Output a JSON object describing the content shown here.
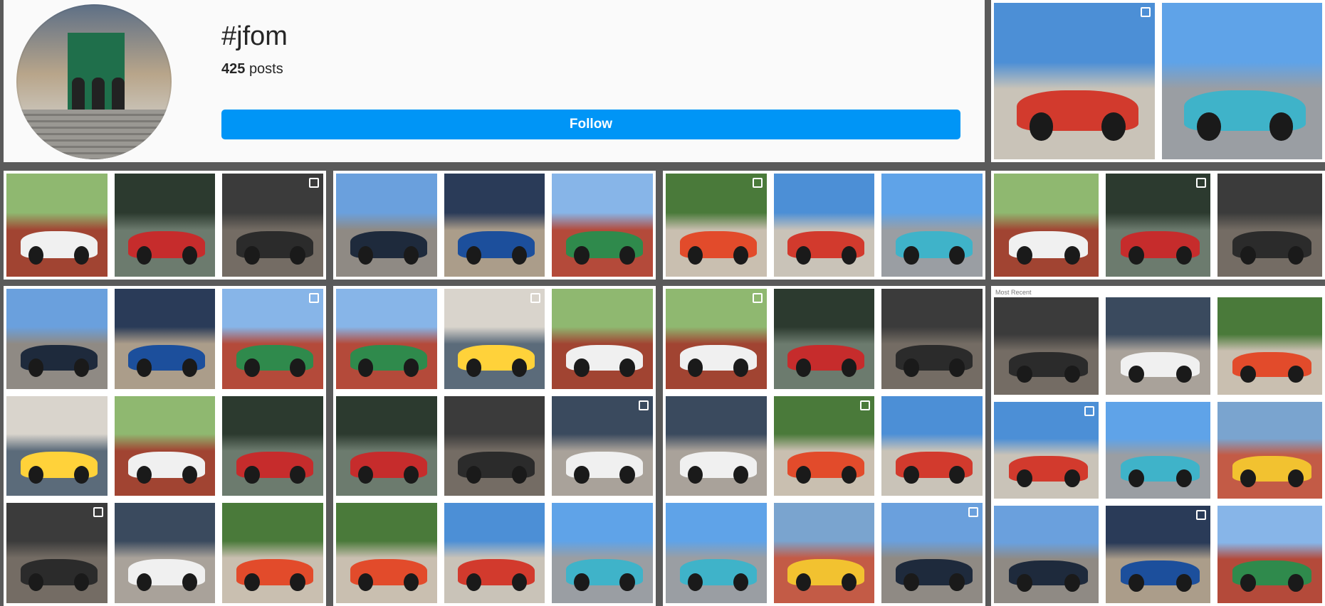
{
  "header": {
    "tag": "#jfom",
    "posts_count": "425",
    "posts_word": "posts",
    "follow_label": "Follow"
  },
  "overlay_label": "Most Recent",
  "colors": {
    "follow_blue": "#0095f6",
    "panel_gap": "#5a5a5a"
  }
}
